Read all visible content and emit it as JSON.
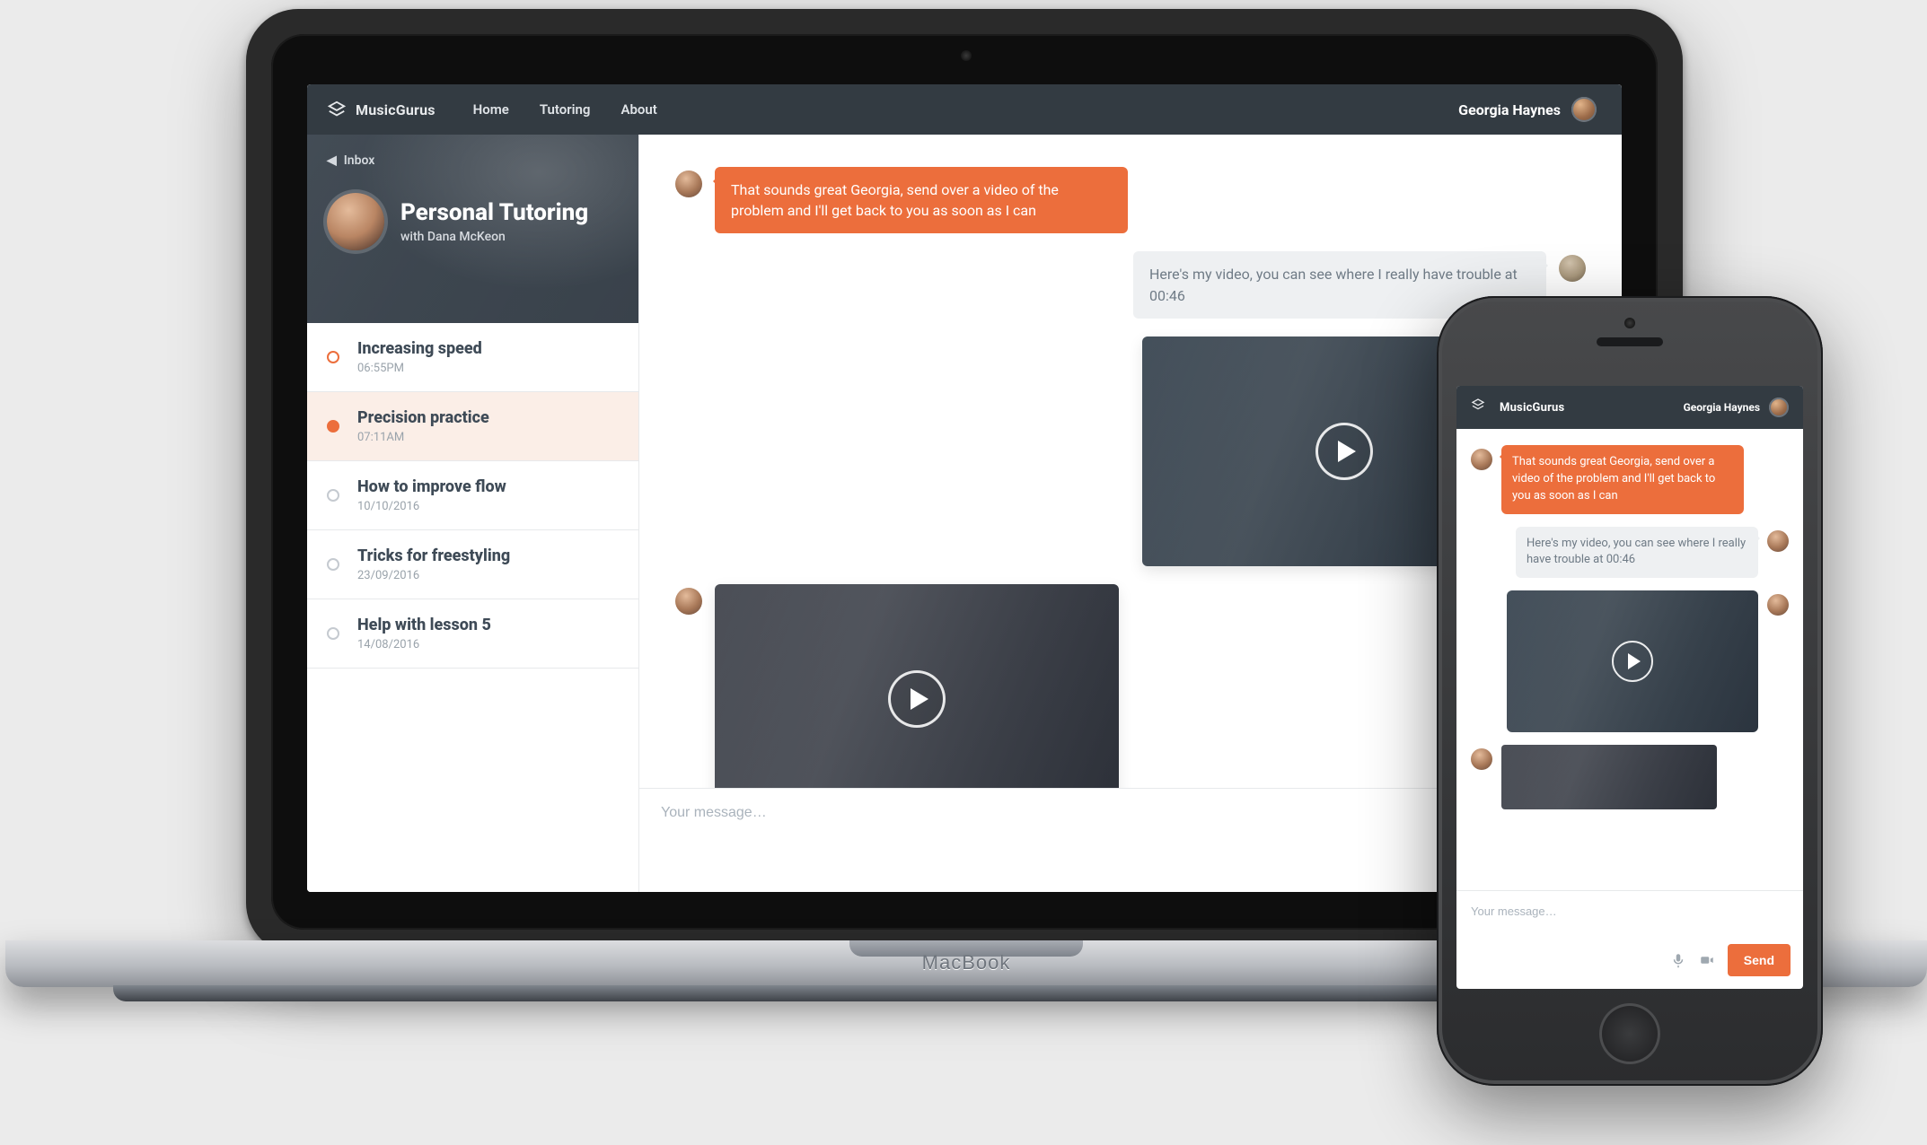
{
  "brand": "MusicGurus",
  "device_brand": "MacBook",
  "nav": {
    "home": "Home",
    "tutoring": "Tutoring",
    "about": "About"
  },
  "user": {
    "name": "Georgia Haynes"
  },
  "colors": {
    "accent": "#ec6e3c",
    "accent_soft": "#fbeee7",
    "topbar_bg": "#333b42",
    "bubble_other": "#eef0f2"
  },
  "sidebar": {
    "back_label": "Inbox",
    "title": "Personal Tutoring",
    "with_label": "with Dana McKeon",
    "threads": [
      {
        "title": "Increasing speed",
        "time": "06:55PM",
        "state": "outline"
      },
      {
        "title": "Precision practice",
        "time": "07:11AM",
        "state": "active"
      },
      {
        "title": "How to improve flow",
        "time": "10/10/2016",
        "state": "done"
      },
      {
        "title": "Tricks for freestyling",
        "time": "23/09/2016",
        "state": "done"
      },
      {
        "title": "Help with lesson 5",
        "time": "14/08/2016",
        "state": "done"
      }
    ]
  },
  "messages": {
    "m0": "That sounds great Georgia, send over a video of the problem and I'll get back to you as soon as I can",
    "m1": "Here's my video, you can see where I really have trouble at 00:46"
  },
  "composer": {
    "placeholder": "Your message…",
    "send_label": "Send"
  },
  "icons": {
    "logo": "logo-icon",
    "back": "back-icon",
    "play": "play-icon",
    "mic": "mic-icon",
    "video": "camera-icon"
  }
}
